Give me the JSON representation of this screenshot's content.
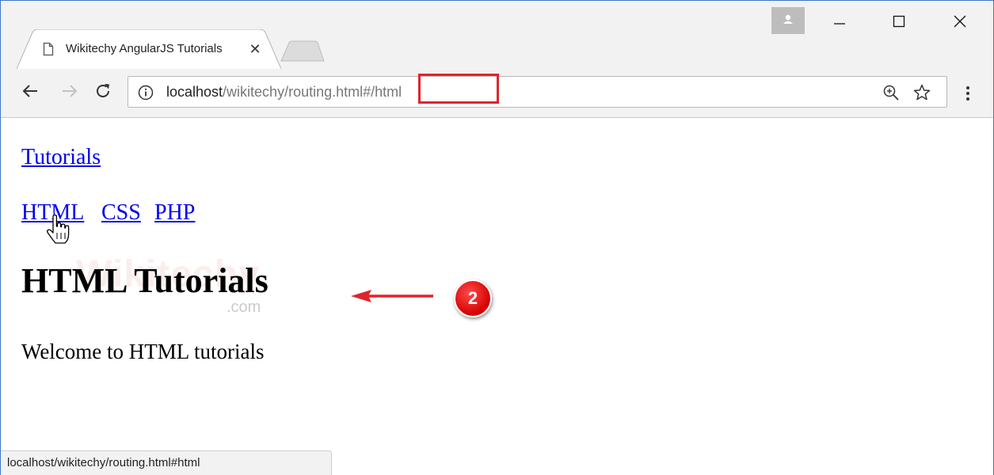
{
  "tab": {
    "title": "Wikitechy AngularJS Tutorials",
    "page_icon": "document-icon",
    "close_label": "✕"
  },
  "omnibox": {
    "url_host": "localhost",
    "url_path": "/wikitechy/routing.html#/html",
    "highlight_color": "#e0242b"
  },
  "window_controls": [
    "minimize-icon",
    "maximize-icon",
    "close-icon"
  ],
  "page": {
    "link_tutorials": "Tutorials",
    "nav_links": [
      "HTML",
      "CSS",
      "PHP"
    ],
    "heading": "HTML Tutorials",
    "paragraph": "Welcome to HTML tutorials",
    "watermark_brand": "Wikitechy",
    "watermark_com": ".com"
  },
  "annotation": {
    "step_number": "2",
    "color": "#e0242b"
  },
  "status_bar": {
    "text": "localhost/wikitechy/routing.html#html"
  },
  "colors": {
    "link": "#0000ee",
    "chrome_bg": "#f2f2f2",
    "window_border": "#3c78c4"
  }
}
